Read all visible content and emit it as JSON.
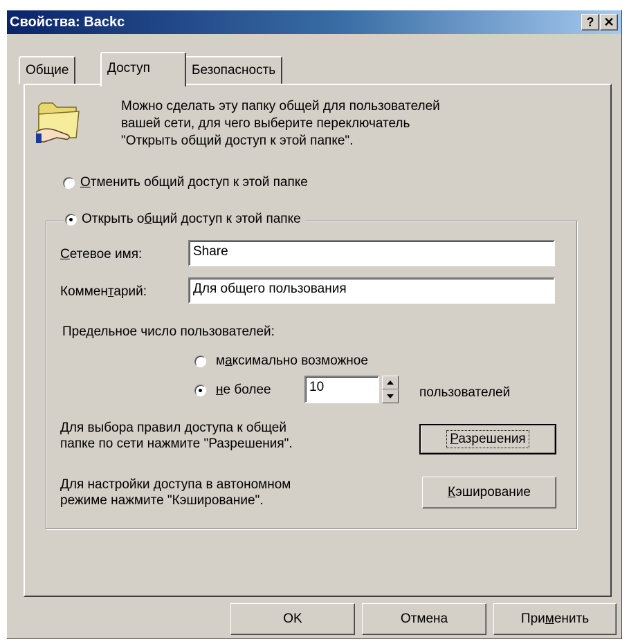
{
  "window": {
    "title": "Свойства: Backc",
    "help_label": "?",
    "close_label": "✕"
  },
  "tabs": [
    {
      "label": "Общие",
      "active": false
    },
    {
      "label": "Доступ",
      "active": true
    },
    {
      "label": "Безопасность",
      "active": false
    }
  ],
  "sharing": {
    "folder_icon": "shared-folder-icon",
    "intro_lines": [
      "Можно сделать эту папку общей для пользователей",
      "вашей сети, для чего выберите переключатель",
      "\"Открыть общий доступ к этой папке\"."
    ],
    "no_share": {
      "pre": "",
      "key": "О",
      "post": "тменить общий доступ к этой папке",
      "checked": false
    },
    "share": {
      "pre": "Открыть о",
      "key": "б",
      "post": "щий доступ к этой папке",
      "checked": true
    },
    "share_name": {
      "pre": "",
      "key": "С",
      "post": "етевое имя:",
      "value": "Share"
    },
    "comment": {
      "pre": "Коммен",
      "key": "т",
      "post": "арий:",
      "value": "Для общего пользования"
    },
    "user_limit_label": "Предельное число пользователей:",
    "max_allowed": {
      "pre": "м",
      "key": "а",
      "post": "ксимально возможное",
      "checked": false
    },
    "allow": {
      "pre": "",
      "key": "н",
      "post": "е более",
      "checked": true,
      "value": "10",
      "suffix": "пользователей"
    },
    "permissions_text": [
      "Для выбора правил доступа к общей",
      "папке по сети нажмите \"Разрешения\"."
    ],
    "permissions_button": {
      "pre": "",
      "key": "Р",
      "post": "азрешения"
    },
    "caching_text": [
      "Для настройки доступа в автономном",
      "режиме нажмите \"Кэширование\"."
    ],
    "caching_button": {
      "pre": "",
      "key": "К",
      "post": "эширование"
    }
  },
  "footer": {
    "ok_label": "OK",
    "cancel_label": "Отмена",
    "apply": {
      "pre": "При",
      "key": "м",
      "post": "енить"
    }
  },
  "colors": {
    "face": "#d4d0c8",
    "title_start": "#0a246a",
    "title_end": "#a6caf0"
  }
}
